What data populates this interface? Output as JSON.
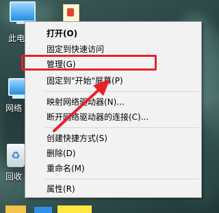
{
  "desktop": {
    "icons": [
      {
        "label": "此电"
      },
      {
        "label": "网络"
      },
      {
        "label": "回收"
      }
    ]
  },
  "context_menu": {
    "items": [
      {
        "label": "打开(O)"
      },
      {
        "label": "固定到快速访问"
      },
      {
        "label": "管理(G)"
      },
      {
        "label": "固定到\"开始\"屏幕(P)"
      },
      {
        "label": "映射网络驱动器(N)..."
      },
      {
        "label": "断开网络驱动器的连接(C)..."
      },
      {
        "label": "创建快捷方式(S)"
      },
      {
        "label": "删除(D)"
      },
      {
        "label": "重命名(M)"
      },
      {
        "label": "属性(R)"
      }
    ]
  },
  "annotation": {
    "highlight_color": "#e8202a",
    "arrow_color": "#e8202a"
  }
}
